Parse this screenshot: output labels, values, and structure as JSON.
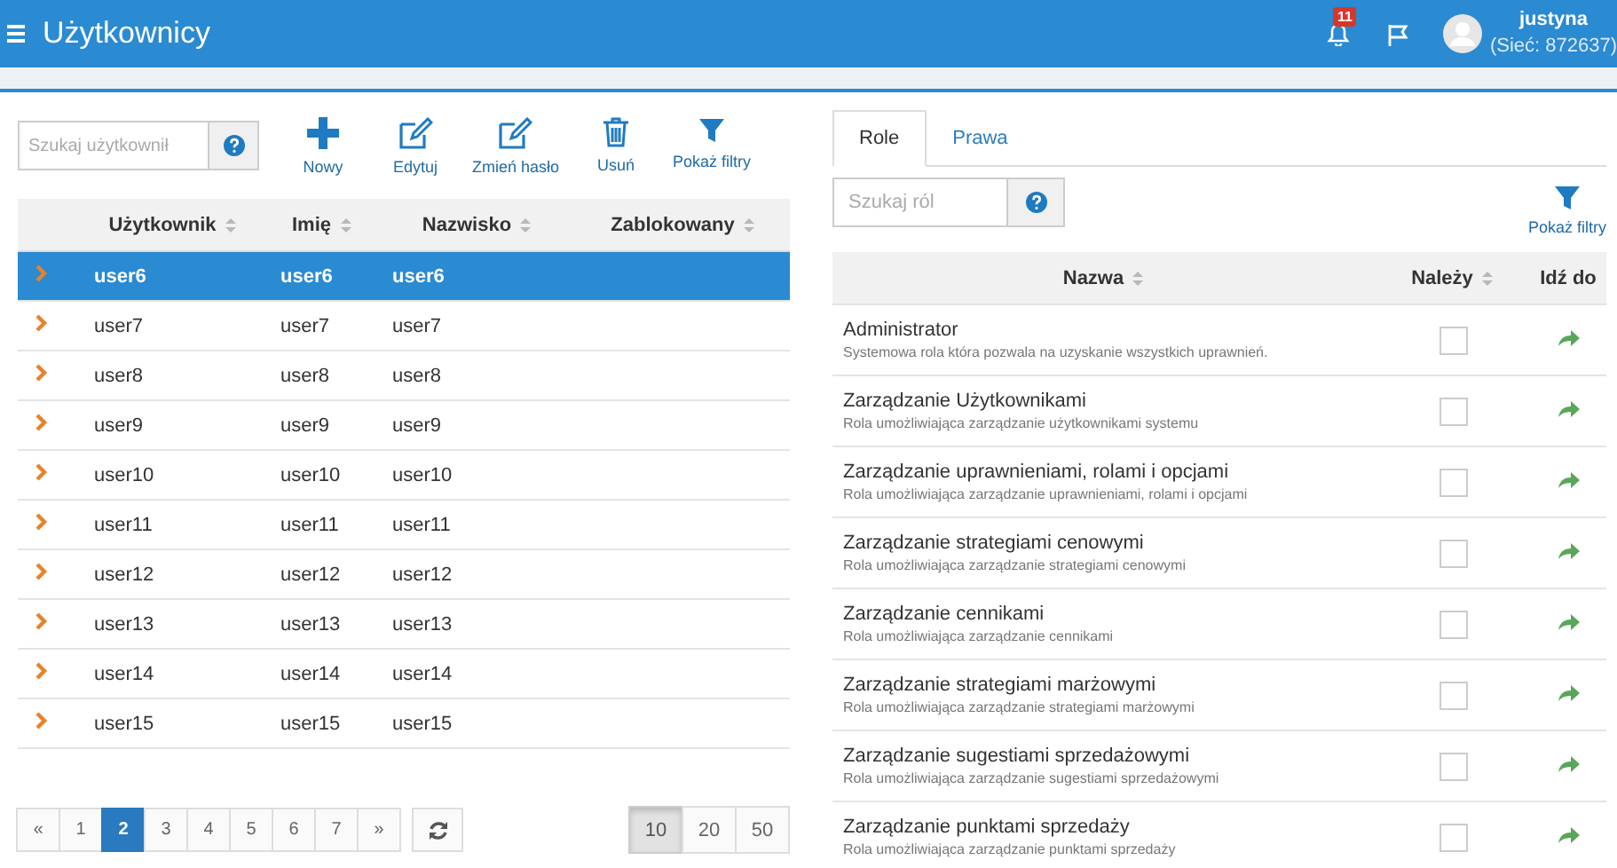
{
  "header": {
    "title": "Użytkownicy",
    "notification_count": "11",
    "user_name": "justyna",
    "network": "(Sieć: 872637)"
  },
  "users": {
    "search": {
      "placeholder": "Szukaj użytkownił"
    },
    "toolbar": [
      {
        "kind": "plus",
        "label": "Nowy"
      },
      {
        "kind": "edit",
        "label": "Edytuj"
      },
      {
        "kind": "edit",
        "label": "Zmień hasło"
      },
      {
        "kind": "trash",
        "label": "Usuń"
      },
      {
        "kind": "filter",
        "label": "Pokaż filtry"
      }
    ],
    "columns": [
      "Użytkownik",
      "Imię",
      "Nazwisko",
      "Zablokowany"
    ],
    "rows": [
      {
        "user": "user6",
        "first_name": "user6",
        "last_name": "user6",
        "selected": true
      },
      {
        "user": "user7",
        "first_name": "user7",
        "last_name": "user7",
        "selected": false
      },
      {
        "user": "user8",
        "first_name": "user8",
        "last_name": "user8",
        "selected": false
      },
      {
        "user": "user9",
        "first_name": "user9",
        "last_name": "user9",
        "selected": false
      },
      {
        "user": "user10",
        "first_name": "user10",
        "last_name": "user10",
        "selected": false
      },
      {
        "user": "user11",
        "first_name": "user11",
        "last_name": "user11",
        "selected": false
      },
      {
        "user": "user12",
        "first_name": "user12",
        "last_name": "user12",
        "selected": false
      },
      {
        "user": "user13",
        "first_name": "user13",
        "last_name": "user13",
        "selected": false
      },
      {
        "user": "user14",
        "first_name": "user14",
        "last_name": "user14",
        "selected": false
      },
      {
        "user": "user15",
        "first_name": "user15",
        "last_name": "user15",
        "selected": false
      }
    ],
    "pagination": [
      {
        "label": "«",
        "selected": false
      },
      {
        "label": "1",
        "selected": false
      },
      {
        "label": "2",
        "selected": true
      },
      {
        "label": "3",
        "selected": false
      },
      {
        "label": "4",
        "selected": false
      },
      {
        "label": "5",
        "selected": false
      },
      {
        "label": "6",
        "selected": false
      },
      {
        "label": "7",
        "selected": false
      },
      {
        "label": "»",
        "selected": false
      }
    ],
    "page_sizes": [
      {
        "label": "10",
        "selected": true
      },
      {
        "label": "20",
        "selected": false
      },
      {
        "label": "50",
        "selected": false
      }
    ]
  },
  "roles": {
    "tabs": [
      {
        "label": "Role",
        "selected": true
      },
      {
        "label": "Prawa",
        "selected": false
      }
    ],
    "search": {
      "placeholder": "Szukaj ról"
    },
    "filter_label": "Pokaż filtry",
    "columns": [
      "Nazwa",
      "Należy",
      "Idź do"
    ],
    "rows": [
      {
        "name": "Administrator",
        "description": "Systemowa rola która pozwala na uzyskanie wszystkich uprawnień.",
        "member": false
      },
      {
        "name": "Zarządzanie Użytkownikami",
        "description": "Rola umożliwiająca zarządzanie użytkownikami systemu",
        "member": false
      },
      {
        "name": "Zarządzanie uprawnieniami, rolami i opcjami",
        "description": "Rola umożliwiająca zarządzanie uprawnieniami, rolami i opcjami",
        "member": false
      },
      {
        "name": "Zarządzanie strategiami cenowymi",
        "description": "Rola umożliwiająca zarządzanie strategiami cenowymi",
        "member": false
      },
      {
        "name": "Zarządzanie cennikami",
        "description": "Rola umożliwiająca zarządzanie cennikami",
        "member": false
      },
      {
        "name": "Zarządzanie strategiami marżowymi",
        "description": "Rola umożliwiająca zarządzanie strategiami marżowymi",
        "member": false
      },
      {
        "name": "Zarządzanie sugestiami sprzedażowymi",
        "description": "Rola umożliwiająca zarządzanie sugestiami sprzedażowymi",
        "member": false
      },
      {
        "name": "Zarządzanie punktami sprzedaży",
        "description": "Rola umożliwiająca zarządzanie punktami sprzedaży",
        "member": false
      }
    ]
  }
}
